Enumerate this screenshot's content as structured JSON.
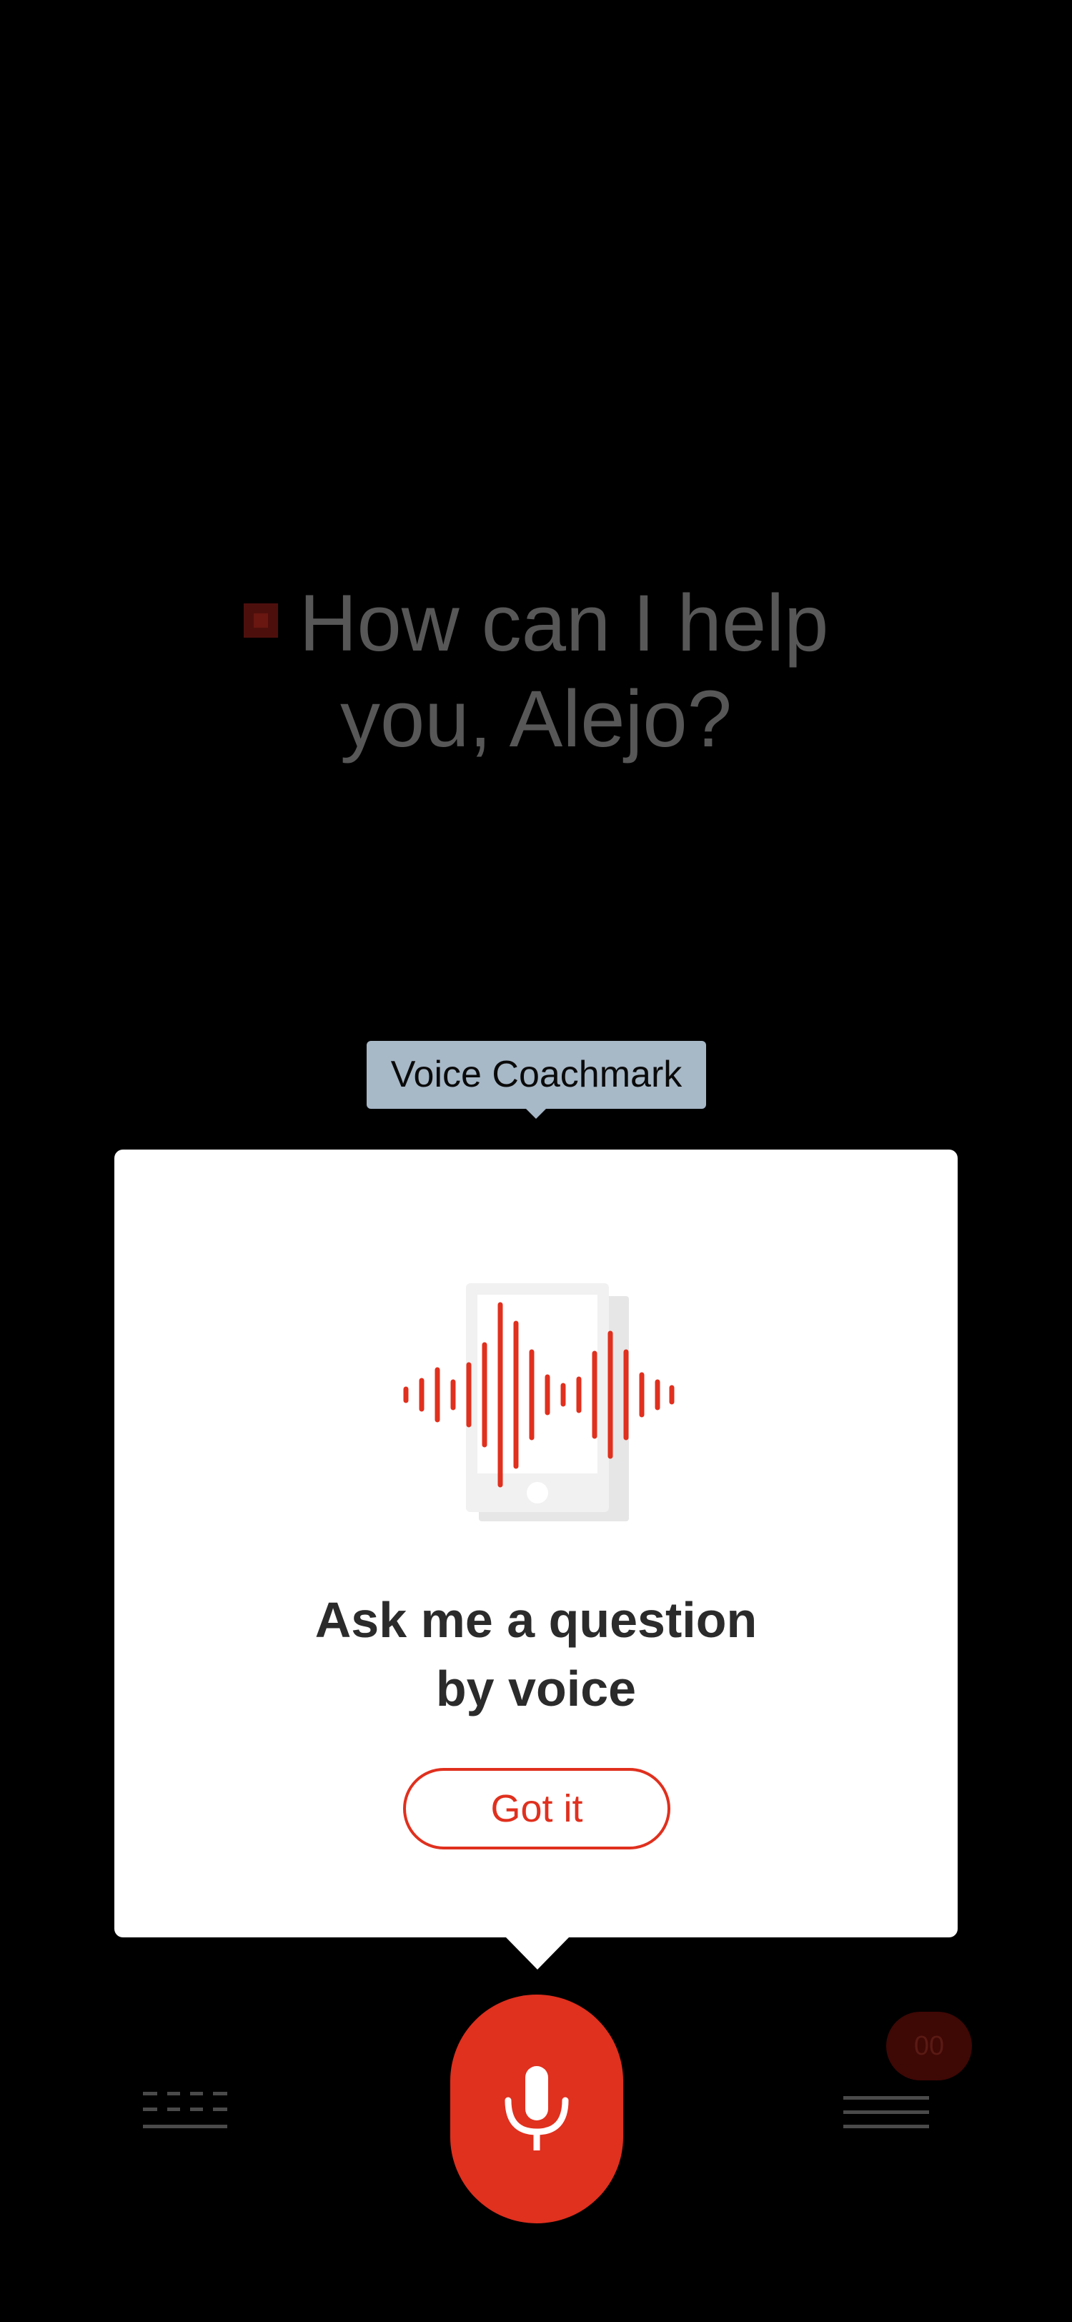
{
  "greeting": {
    "line1": "How can I help",
    "line2": "you, Alejo?"
  },
  "coachmark": {
    "label": "Voice Coachmark",
    "title_line1": "Ask me a question",
    "title_line2": "by voice",
    "button_label": "Got it"
  },
  "bottom_bar": {
    "badge_count": "00"
  },
  "colors": {
    "accent": "#e0301e",
    "background": "#000000",
    "card": "#ffffff",
    "coachmark_label_bg": "#a7b8c7"
  },
  "icons": {
    "keyboard": "keyboard-icon",
    "microphone": "microphone-icon",
    "menu": "menu-icon",
    "illustration": "phone-soundwave-illustration"
  }
}
